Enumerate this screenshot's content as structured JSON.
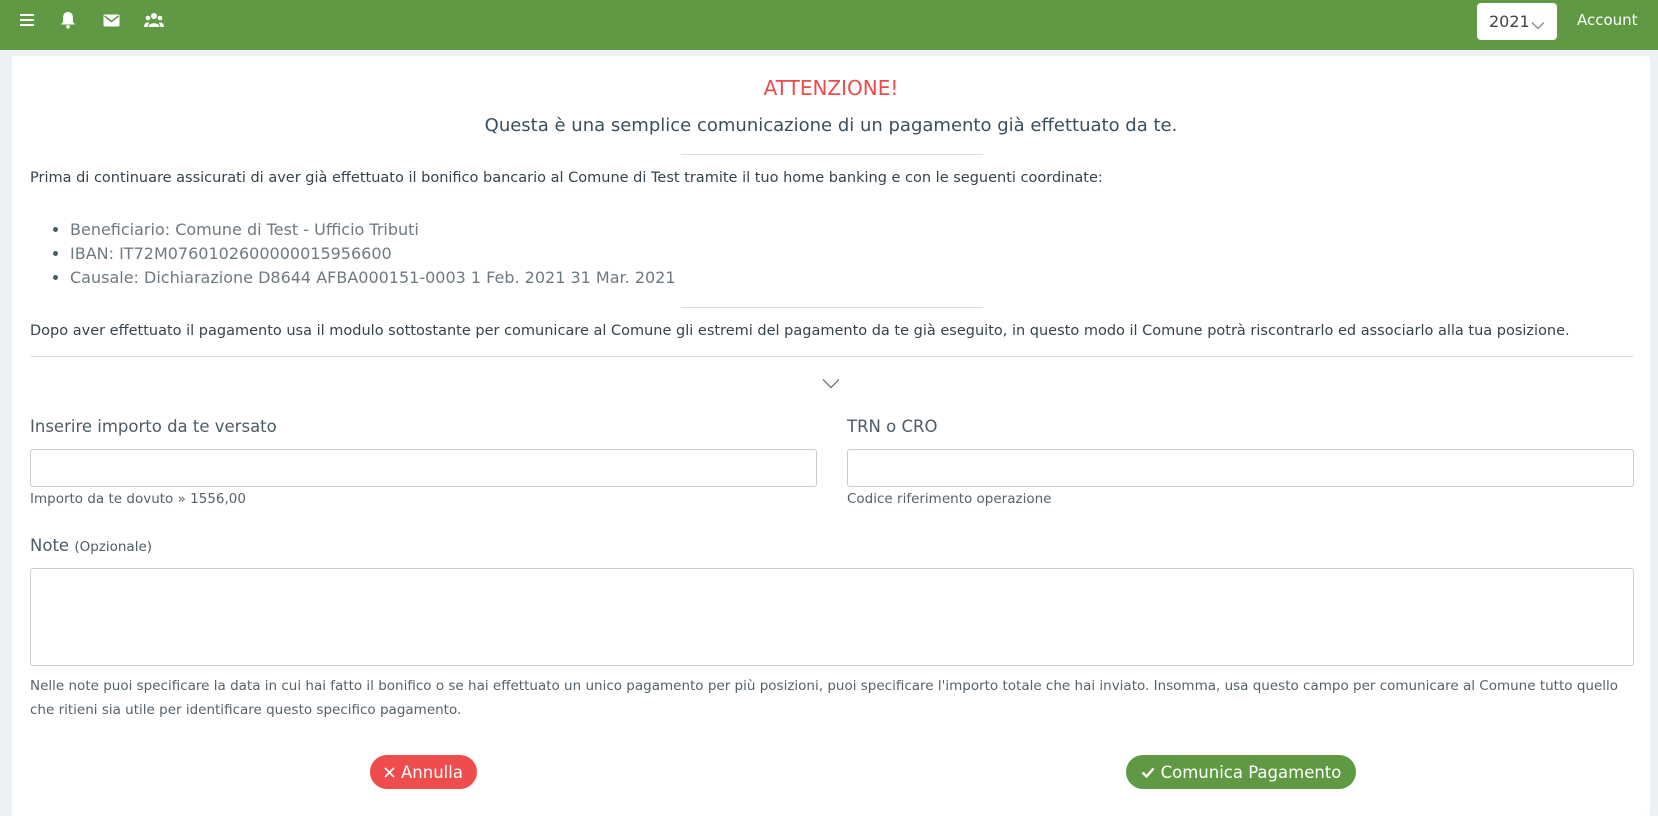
{
  "header": {
    "icons": [
      "menu-icon",
      "bell-icon",
      "mail-icon",
      "users-icon"
    ],
    "year": "2021",
    "account_label": "Account"
  },
  "notice": {
    "title": "ATTENZIONE!",
    "subtitle": "Questa è una semplice comunicazione di un pagamento già effettuato da te.",
    "intro": "Prima di continuare assicurati di aver già effettuato il bonifico bancario al Comune di Test tramite il tuo home banking e con le seguenti coordinate:",
    "coordinates": [
      "Beneficiario: Comune di Test - Ufficio Tributi",
      "IBAN: IT72M0760102600000015956600",
      "Causale: Dichiarazione D8644 AFBA000151-0003 1 Feb. 2021 31 Mar. 2021"
    ],
    "instructions": "Dopo aver effettuato il pagamento usa il modulo sottostante per comunicare al Comune gli estremi del pagamento da te già eseguito, in questo modo il Comune potrà riscontrarlo ed associarlo alla tua posizione."
  },
  "form": {
    "amount": {
      "label": "Inserire importo da te versato",
      "value": "",
      "help": "Importo da te dovuto » 1556,00"
    },
    "trn": {
      "label": "TRN o CRO",
      "value": "",
      "help": "Codice riferimento operazione"
    },
    "note": {
      "label": "Note",
      "optional": "(Opzionale)",
      "value": "",
      "help": "Nelle note puoi specificare la data in cui hai fatto il bonifico o se hai effettuato un unico pagamento per più posizioni, puoi specificare l'importo totale che hai inviato. Insomma, usa questo campo per comunicare al Comune tutto quello che ritieni sia utile per identificare questo specifico pagamento."
    }
  },
  "actions": {
    "cancel_label": "Annulla",
    "submit_label": "Comunica Pagamento"
  },
  "colors": {
    "brand_green": "#5f9944",
    "danger_red": "#ef4d4d"
  }
}
